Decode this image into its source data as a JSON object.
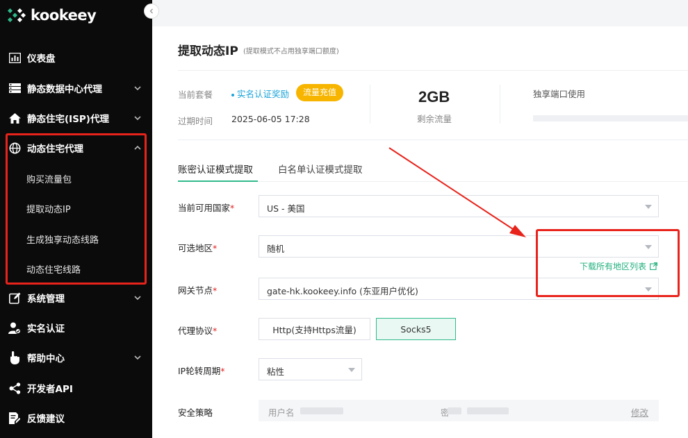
{
  "brand": {
    "name": "kookeey"
  },
  "sidebar": {
    "items": [
      {
        "label": "仪表盘",
        "icon": "dashboard-icon"
      },
      {
        "label": "静态数据中心代理",
        "icon": "server-icon"
      },
      {
        "label": "静态住宅(ISP)代理",
        "icon": "home-icon"
      },
      {
        "label": "动态住宅代理",
        "icon": "globe-icon"
      },
      {
        "label": "系统管理",
        "icon": "edit-icon"
      },
      {
        "label": "实名认证",
        "icon": "user-check-icon"
      },
      {
        "label": "帮助中心",
        "icon": "hand-pointer-icon"
      },
      {
        "label": "开发者API",
        "icon": "share-nodes-icon"
      },
      {
        "label": "反馈建议",
        "icon": "document-edit-icon"
      }
    ],
    "sub_items": [
      "购买流量包",
      "提取动态IP",
      "生成独享动态线路",
      "动态住宅线路"
    ]
  },
  "page": {
    "title": "提取动态IP",
    "subtitle": "(提取模式不占用独享端口额度)"
  },
  "summary": {
    "plan_label": "当前套餐",
    "plan_value": "实名认证奖励",
    "recharge_button": "流量充值",
    "expire_label": "过期时间",
    "expire_value": "2025-06-05 17:28",
    "traffic_value": "2GB",
    "traffic_label": "剩余流量",
    "port_usage_label": "独享端口使用"
  },
  "tabs": [
    {
      "label": "账密认证模式提取",
      "active": true
    },
    {
      "label": "白名单认证模式提取",
      "active": false
    }
  ],
  "form": {
    "country_label": "当前可用国家",
    "country_value": "US - 美国",
    "region_label": "可选地区",
    "region_value": "随机",
    "download_link": "下载所有地区列表",
    "gateway_label": "网关节点",
    "gateway_value": "gate-hk.kookeey.info (东亚用户优化)",
    "protocol_label": "代理协议",
    "protocol_options": [
      "Http(支持Https流量)",
      "Socks5"
    ],
    "protocol_selected": "Socks5",
    "rotation_label": "IP轮转周期",
    "rotation_value": "粘性",
    "security_label": "安全策略",
    "username_label": "用户名",
    "password_fragment": "密",
    "modify_link": "修改"
  },
  "colors": {
    "accent_green": "#2fb98a",
    "badge_yellow": "#f7b500",
    "link_blue": "#1aa3d9",
    "annotation_red": "#e8231b",
    "sidebar_bg": "#0b0b0b"
  }
}
